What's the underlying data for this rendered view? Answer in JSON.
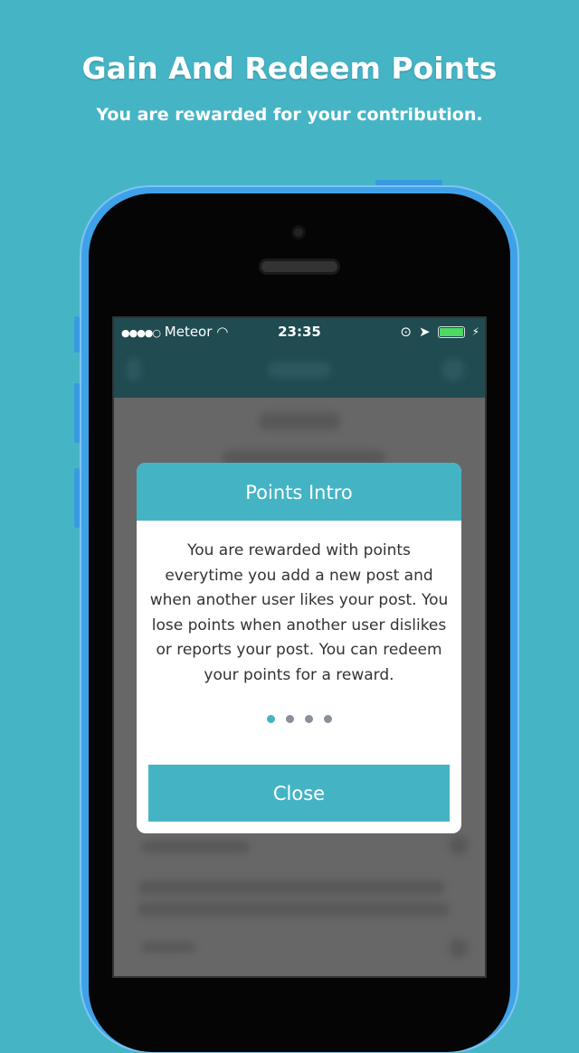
{
  "header": {
    "title": "Gain And Redeem Points",
    "subtitle": "You are rewarded for your contribution."
  },
  "status_bar": {
    "signal": "●●●●○",
    "carrier": "Meteor",
    "time": "23:35",
    "battery_level": 1.0
  },
  "modal": {
    "title": "Points Intro",
    "body": "You are rewarded with points everytime you add a new post and when another user likes your post. You lose points when another user dislikes or reports your post. You can redeem your points for a reward.",
    "page_count": 4,
    "active_page": 1,
    "close_label": "Close"
  },
  "colors": {
    "accent": "#44b4c5",
    "background": "#45b5c6",
    "phone": "#3fa2e8"
  }
}
